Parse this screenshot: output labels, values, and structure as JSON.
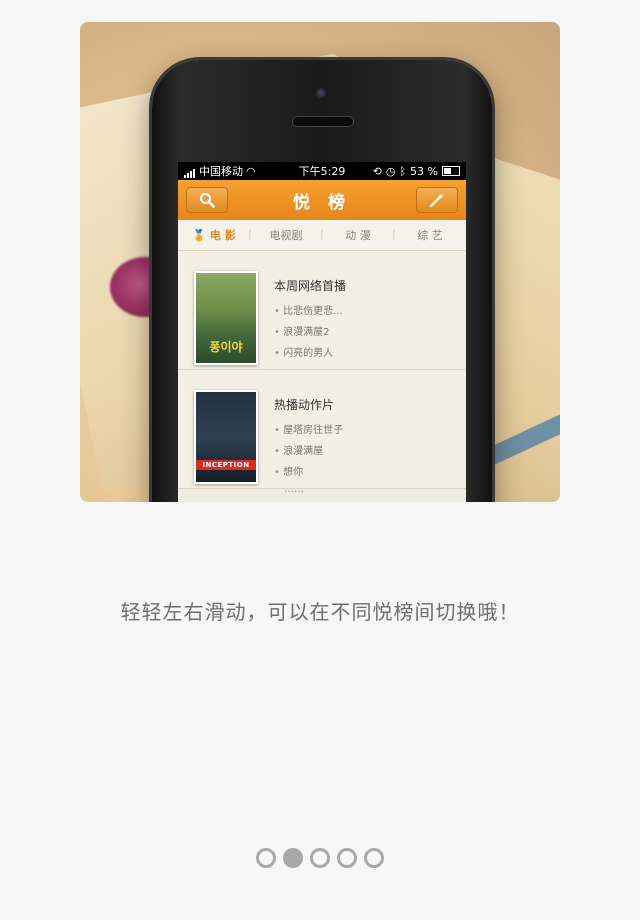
{
  "status_bar": {
    "carrier": "中国移动",
    "time": "下午5:29",
    "battery": "53 %"
  },
  "app": {
    "title": "悦 榜",
    "search_icon": "search-icon",
    "magic_icon": "magic-wand-icon",
    "accent": "#e6851b"
  },
  "tabs": [
    {
      "label": "电 影",
      "active": true
    },
    {
      "label": "电视剧",
      "active": false
    },
    {
      "label": "动 漫",
      "active": false
    },
    {
      "label": "综 艺",
      "active": false
    }
  ],
  "sections": [
    {
      "title": "本周网络首播",
      "poster_caption": "퐁이야",
      "items": [
        "比悲伤更悲...",
        "浪漫满屋2",
        "闪亮的男人"
      ],
      "more": "……"
    },
    {
      "title": "热播动作片",
      "poster_caption": "INCEPTION",
      "items": [
        "屋塔房往世子",
        "浪漫满屋",
        "想你"
      ],
      "more": "……"
    }
  ],
  "caption": "轻轻左右滑动，可以在不同悦榜间切换哦！",
  "pagination": {
    "count": 5,
    "active_index": 1
  }
}
